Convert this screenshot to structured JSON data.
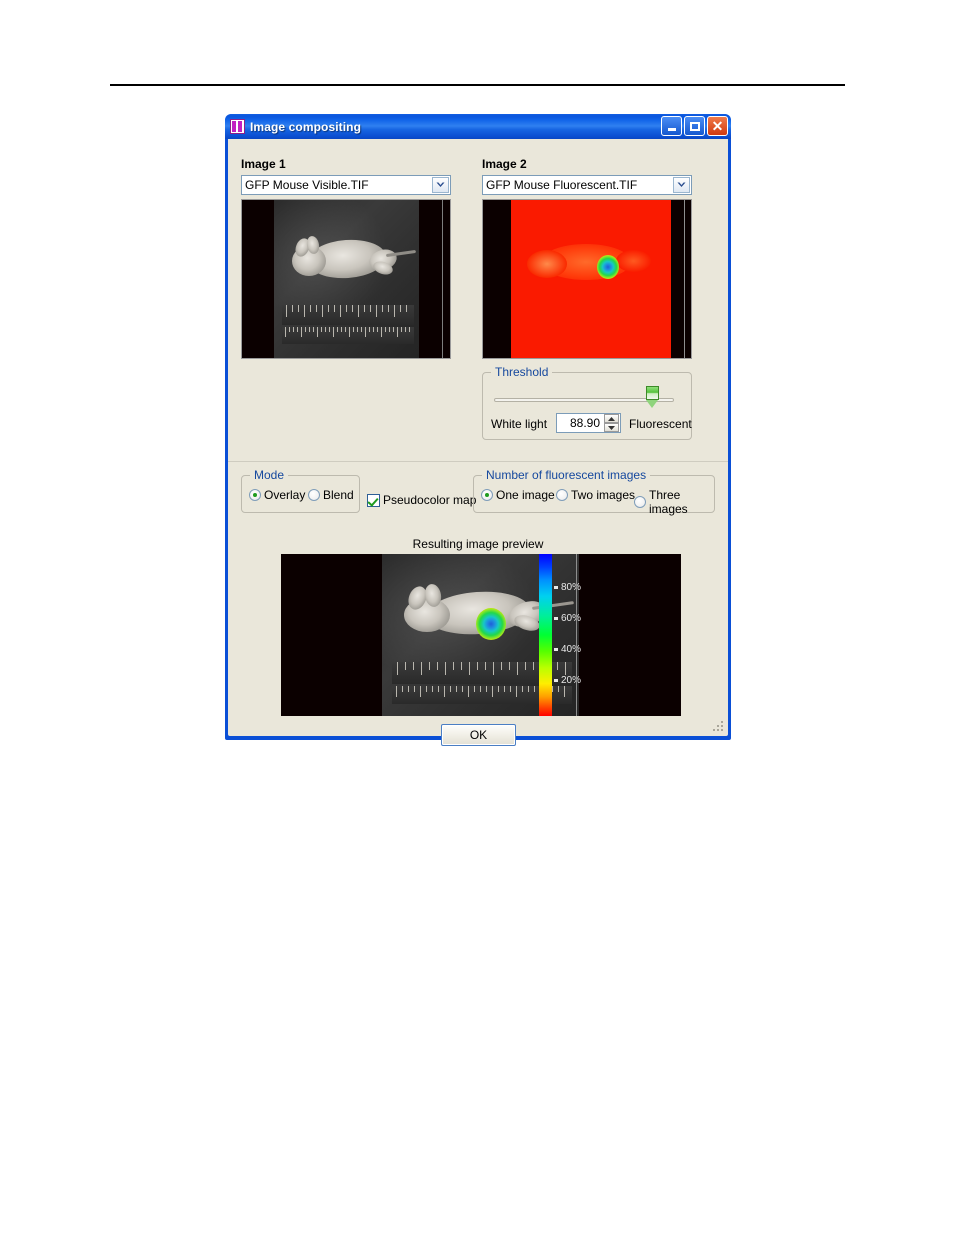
{
  "window": {
    "title": "Image compositing",
    "icon": "app-icon",
    "buttons": {
      "minimize": "minimize-icon",
      "maximize": "maximize-icon",
      "close": "close-icon"
    }
  },
  "image1": {
    "label": "Image 1",
    "selected_file": "GFP Mouse Visible.TIF",
    "preview_alt": "grayscale visible-light photo of a mouse with ruler"
  },
  "image2": {
    "label": "Image 2",
    "selected_file": "GFP Mouse Fluorescent.TIF",
    "preview_alt": "red pseudocolor fluorescent image of a mouse with bright spot"
  },
  "threshold": {
    "title": "Threshold",
    "left_label": "White light",
    "right_label": "Fluorescent",
    "value": "88.90",
    "slider_percent": 88.9,
    "min": 0,
    "max": 100
  },
  "mode": {
    "title": "Mode",
    "options": [
      {
        "label": "Overlay",
        "selected": true
      },
      {
        "label": "Blend",
        "selected": false
      }
    ]
  },
  "pseudocolor": {
    "label": "Pseudocolor map",
    "checked": true
  },
  "fluorescent_count": {
    "title": "Number of fluorescent images",
    "options": [
      {
        "label": "One image",
        "selected": true
      },
      {
        "label": "Two images",
        "selected": false
      },
      {
        "label": "Three images",
        "selected": false
      }
    ]
  },
  "preview": {
    "label": "Resulting image preview",
    "colorbar": {
      "ticks": [
        "80%",
        "60%",
        "40%",
        "20%"
      ],
      "top_color": "#0000ff",
      "bottom_color": "#ff0000"
    }
  },
  "footer": {
    "ok_label": "OK"
  },
  "colors": {
    "dialog_bg": "#eae7da",
    "titlebar": "#0a4fd6",
    "group_title": "#15489e",
    "accent_green": "#1f9b1f"
  }
}
